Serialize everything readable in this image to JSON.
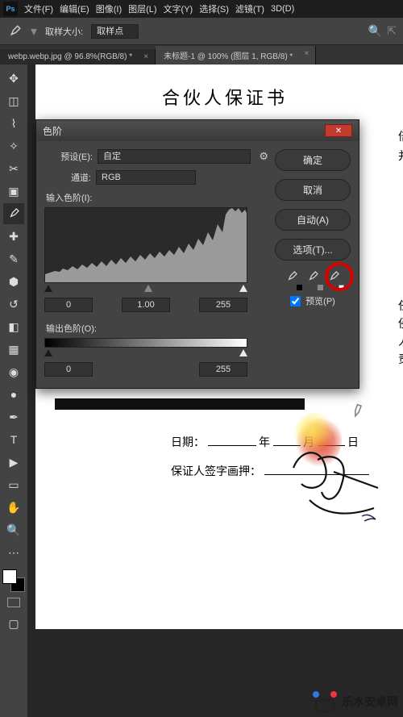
{
  "app": {
    "logo": "Ps"
  },
  "menu": {
    "file": "文件(F)",
    "edit": "编辑(E)",
    "image": "图像(I)",
    "layer": "图层(L)",
    "type": "文字(Y)",
    "select": "选择(S)",
    "filter": "滤镜(T)",
    "threed": "3D(D)"
  },
  "options": {
    "sample_label": "取样大小:",
    "sample_value": "取样点"
  },
  "tabs": {
    "t1": "webp.webp.jpg @ 96.8%(RGB/8) *",
    "t2": "未标题-1 @ 100% (图层 1, RGB/8) *"
  },
  "document": {
    "title": "合伙人保证书",
    "frag1": "倍",
    "frag2": "并",
    "frag3a": "任",
    "frag3b": "侵",
    "frag3c": "人",
    "frag3d": "责",
    "date_label": "日期：",
    "year": "年",
    "month": "月",
    "day": "日",
    "sign_label": "保证人签字画押："
  },
  "levels": {
    "title": "色阶",
    "preset_label": "预设(E):",
    "preset_value": "自定",
    "channel_label": "通道:",
    "channel_value": "RGB",
    "input_label": "输入色阶(I):",
    "in_black": "0",
    "in_gamma": "1.00",
    "in_white": "255",
    "output_label": "输出色阶(O):",
    "out_black": "0",
    "out_white": "255",
    "ok": "确定",
    "cancel": "取消",
    "auto": "自动(A)",
    "options": "选项(T)...",
    "preview": "预览(P)"
  },
  "watermark": {
    "text": "乐水安卓网"
  }
}
